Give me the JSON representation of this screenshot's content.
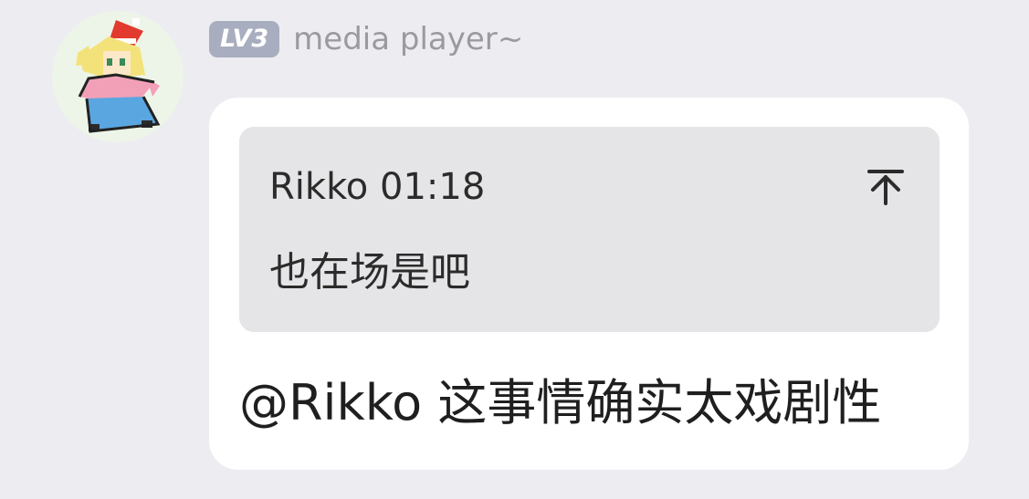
{
  "sender": {
    "avatar_icon": "pixel-character-avatar",
    "level_badge": "LV3",
    "name": "media player~"
  },
  "message": {
    "quote": {
      "author_time": "Rikko 01:18",
      "text": "也在场是吧",
      "action_icon": "jump-to-top-icon"
    },
    "text": "@Rikko 这事情确实太戏剧性"
  },
  "colors": {
    "background": "#ededf1",
    "bubble": "#ffffff",
    "quote_background": "#e5e5e7",
    "badge": "#a8aebf",
    "username": "#9a9aa0",
    "text": "#1f1f1f"
  }
}
